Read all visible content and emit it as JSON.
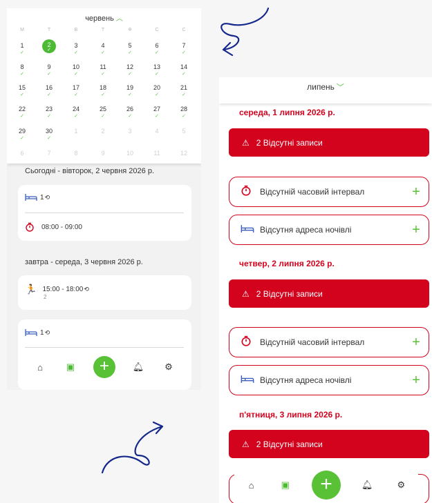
{
  "left": {
    "month": "червень",
    "weekdays": [
      "М",
      "Т",
      "В",
      "Т",
      "Ф",
      "С",
      "С"
    ],
    "weeks": [
      [
        "1",
        "2",
        "3",
        "4",
        "5",
        "6",
        "7"
      ],
      [
        "8",
        "9",
        "10",
        "11",
        "12",
        "13",
        "14"
      ],
      [
        "15",
        "16",
        "17",
        "18",
        "19",
        "20",
        "21"
      ],
      [
        "22",
        "23",
        "24",
        "25",
        "26",
        "27",
        "28"
      ],
      [
        "29",
        "30",
        "1",
        "2",
        "3",
        "4",
        "5"
      ],
      [
        "6",
        "7",
        "8",
        "9",
        "10",
        "11",
        "12"
      ]
    ],
    "today_section": "Сьогодні - вівторок, 2 червня 2026 р.",
    "card1_count": "1",
    "card1_time": "08:00 - 09:00",
    "tomorrow_section": "завтра - середа, 3 червня 2026 р.",
    "card2_time": "15:00 - 18:00",
    "card2_sub": "2",
    "card3_count": "1"
  },
  "right": {
    "month": "липень",
    "days": [
      {
        "date": "середа, 1 липня 2026 р.",
        "alert": "2 Відсутні записи",
        "missing_time": "Відсутній часовий інтервал",
        "missing_address": "Відсутня адреса ночівлі"
      },
      {
        "date": "четвер, 2 липня 2026 р.",
        "alert": "2 Відсутні записи",
        "missing_time": "Відсутній часовий інтервал",
        "missing_address": "Відсутня адреса ночівлі"
      },
      {
        "date": "п'ятниця, 3 липня 2026 р.",
        "alert": "2 Відсутні записи"
      }
    ]
  },
  "colors": {
    "accent_green": "#59c136",
    "alert_red": "#d3031e",
    "arrow_blue": "#14288c"
  },
  "icons": [
    "chevron-up-icon",
    "chevron-down-icon",
    "check-icon",
    "bed-icon",
    "refresh-icon",
    "stopwatch-icon",
    "running-icon",
    "home-icon",
    "calendar-icon",
    "plus-icon",
    "bell-icon",
    "gear-icon",
    "warning-icon"
  ]
}
